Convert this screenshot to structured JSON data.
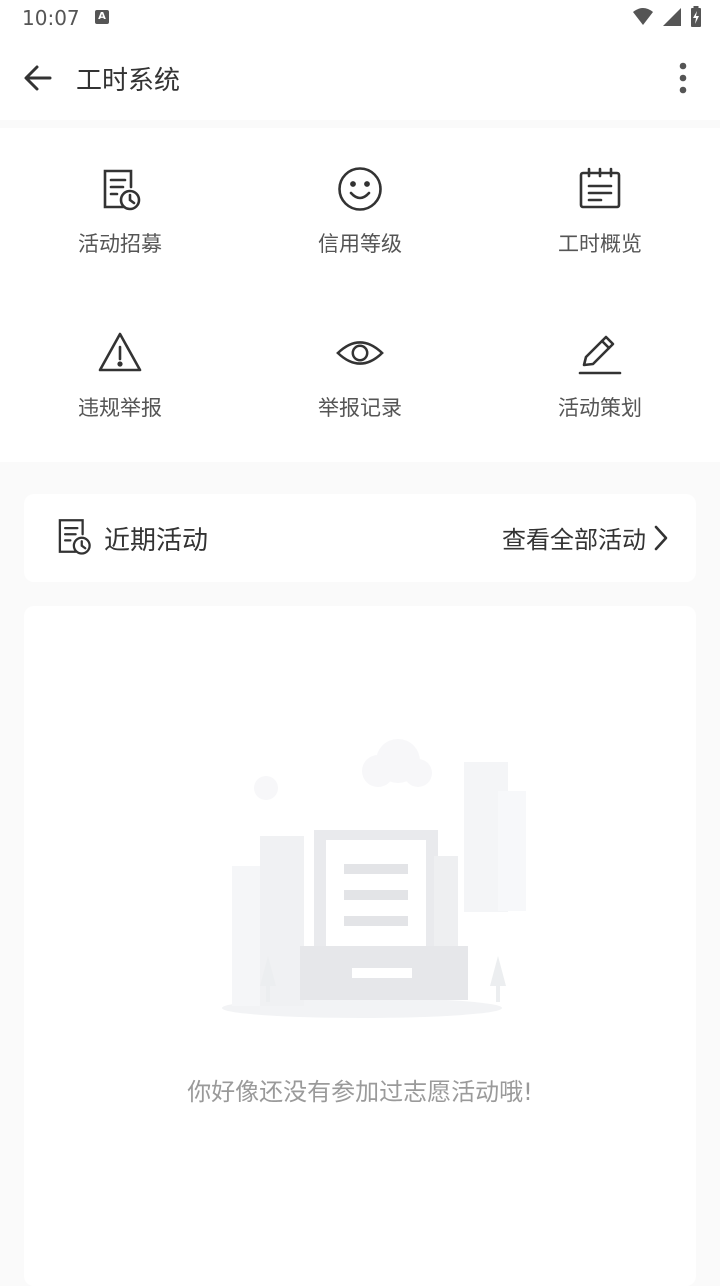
{
  "status": {
    "time": "10:07",
    "badge": "A"
  },
  "appbar": {
    "title": "工时系统"
  },
  "menu": [
    {
      "label": "活动招募",
      "icon": "recruit-doc-clock-icon"
    },
    {
      "label": "信用等级",
      "icon": "smiley-icon"
    },
    {
      "label": "工时概览",
      "icon": "notepad-icon"
    },
    {
      "label": "违规举报",
      "icon": "warning-triangle-icon"
    },
    {
      "label": "举报记录",
      "icon": "eye-icon"
    },
    {
      "label": "活动策划",
      "icon": "pencil-icon"
    }
  ],
  "recent": {
    "title": "近期活动",
    "view_all": "查看全部活动"
  },
  "empty": {
    "message": "你好像还没有参加过志愿活动哦!"
  }
}
